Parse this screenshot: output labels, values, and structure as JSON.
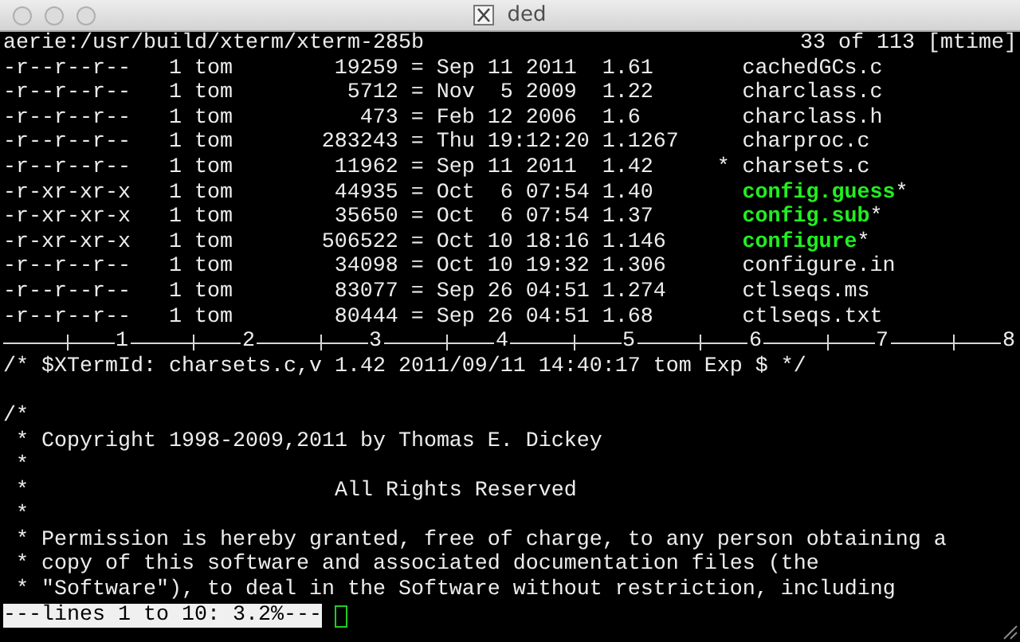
{
  "window": {
    "title": "ded"
  },
  "header": {
    "path": "aerie:/usr/build/xterm/xterm-285b",
    "position": "33 of 113 [mtime]"
  },
  "files": [
    {
      "mode": "-r--r--r--",
      "links": "1",
      "owner": "tom",
      "size": "19259",
      "eq": "=",
      "date": "Sep 11 2011",
      "revision": "1.61",
      "name": "cachedGCs.c",
      "kind": "file"
    },
    {
      "mode": "-r--r--r--",
      "links": "1",
      "owner": "tom",
      "size": "5712",
      "eq": "=",
      "date": "Nov  5 2009",
      "revision": "1.22",
      "name": "charclass.c",
      "kind": "file"
    },
    {
      "mode": "-r--r--r--",
      "links": "1",
      "owner": "tom",
      "size": "473",
      "eq": "=",
      "date": "Feb 12 2006",
      "revision": "1.6",
      "name": "charclass.h",
      "kind": "file"
    },
    {
      "mode": "-r--r--r--",
      "links": "1",
      "owner": "tom",
      "size": "283243",
      "eq": "=",
      "date": "Thu 19:12:20",
      "revision": "1.1267",
      "name": "charproc.c",
      "kind": "file"
    },
    {
      "mode": "-r--r--r--",
      "links": "1",
      "owner": "tom",
      "size": "11962",
      "eq": "=",
      "date": "Sep 11 2011",
      "revision": "1.42",
      "mark": "*",
      "name": "charsets.c",
      "kind": "file"
    },
    {
      "mode": "-r-xr-xr-x",
      "links": "1",
      "owner": "tom",
      "size": "44935",
      "eq": "=",
      "date": "Oct  6 07:54",
      "revision": "1.40",
      "name": "config.guess",
      "suffix": "*",
      "kind": "executable"
    },
    {
      "mode": "-r-xr-xr-x",
      "links": "1",
      "owner": "tom",
      "size": "35650",
      "eq": "=",
      "date": "Oct  6 07:54",
      "revision": "1.37",
      "name": "config.sub",
      "suffix": "*",
      "kind": "executable"
    },
    {
      "mode": "-r-xr-xr-x",
      "links": "1",
      "owner": "tom",
      "size": "506522",
      "eq": "=",
      "date": "Oct 10 18:16",
      "revision": "1.146",
      "name": "configure",
      "suffix": "*",
      "kind": "executable"
    },
    {
      "mode": "-r--r--r--",
      "links": "1",
      "owner": "tom",
      "size": "34098",
      "eq": "=",
      "date": "Oct 10 19:32",
      "revision": "1.306",
      "name": "configure.in",
      "kind": "file"
    },
    {
      "mode": "-r--r--r--",
      "links": "1",
      "owner": "tom",
      "size": "83077",
      "eq": "=",
      "date": "Sep 26 04:51",
      "revision": "1.274",
      "name": "ctlseqs.ms",
      "kind": "file"
    },
    {
      "mode": "-r--r--r--",
      "links": "1",
      "owner": "tom",
      "size": "80444",
      "eq": "=",
      "date": "Sep 26 04:51",
      "revision": "1.68",
      "name": "ctlseqs.txt",
      "kind": "file"
    }
  ],
  "ruler": {
    "labels": [
      "1",
      "2",
      "3",
      "4",
      "5",
      "6",
      "7",
      "8"
    ]
  },
  "lines": [
    {
      "kind": "text",
      "text": "/* $XTermId: charsets.c,v 1.42 2011/09/11 14:40:17 tom Exp $ */"
    },
    {
      "kind": "blank"
    },
    {
      "kind": "text",
      "text": "/*"
    },
    {
      "kind": "text",
      "text": " * Copyright 1998-2009,2011 by Thomas E. Dickey"
    },
    {
      "kind": "text",
      "text": " *"
    },
    {
      "kind": "text",
      "text": " *                        All Rights Reserved"
    },
    {
      "kind": "text",
      "text": " *"
    },
    {
      "kind": "text",
      "text": " * Permission is hereby granted, free of charge, to any person obtaining a"
    },
    {
      "kind": "text",
      "text": " * copy of this software and associated documentation files (the"
    },
    {
      "kind": "text",
      "text": " * \"Software\"), to deal in the Software without restriction, including"
    }
  ],
  "status": {
    "text": "---lines 1 to 10: 3.2%---"
  }
}
